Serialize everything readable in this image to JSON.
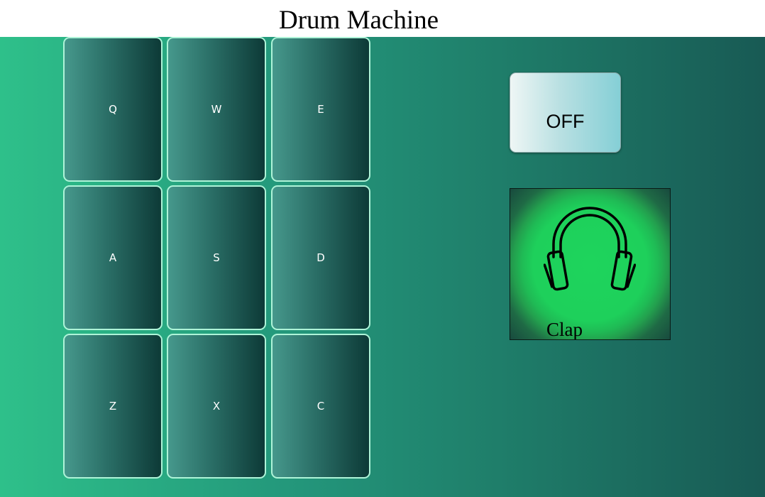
{
  "header": {
    "title": "Drum Machine"
  },
  "pads": [
    {
      "key": "Q"
    },
    {
      "key": "W"
    },
    {
      "key": "E"
    },
    {
      "key": "A"
    },
    {
      "key": "S"
    },
    {
      "key": "D"
    },
    {
      "key": "Z"
    },
    {
      "key": "X"
    },
    {
      "key": "C"
    }
  ],
  "controls": {
    "power_label": "OFF"
  },
  "display": {
    "icon": "headphones-icon",
    "sound_name": "Clap"
  },
  "colors": {
    "pad_border": "#aef4d8",
    "display_green": "#1ed45c",
    "background_left": "#2ec08a",
    "background_right": "#185a54"
  }
}
